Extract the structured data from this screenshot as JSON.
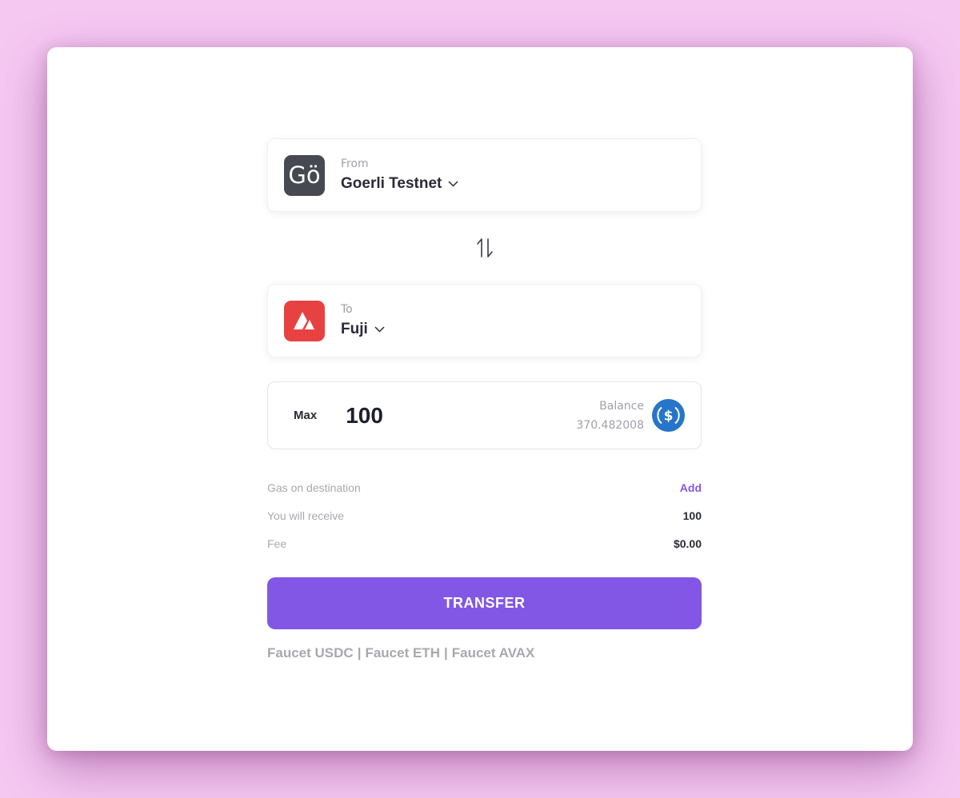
{
  "from": {
    "caption": "From",
    "chain_name": "Goerli Testnet",
    "logo_text": "Gö",
    "logo_color": "#464a50"
  },
  "to": {
    "caption": "To",
    "chain_name": "Fuji",
    "logo_color": "#e84142",
    "logo_icon": "avalanche-logo"
  },
  "amount": {
    "max_label": "Max",
    "value": "100",
    "balance_label": "Balance",
    "balance_value": "370.482008",
    "token_icon": "usdc-icon"
  },
  "details": {
    "gas_label": "Gas on destination",
    "gas_action": "Add",
    "receive_label": "You will receive",
    "receive_value": "100",
    "fee_label": "Fee",
    "fee_value": "$0.00"
  },
  "transfer_label": "TRANSFER",
  "faucets": {
    "usdc": "Faucet USDC",
    "eth": "Faucet ETH",
    "avax": "Faucet AVAX",
    "separator": "|"
  },
  "colors": {
    "accent": "#8257e5",
    "background": "#f5c8f2",
    "usdc_blue": "#2775ca"
  }
}
